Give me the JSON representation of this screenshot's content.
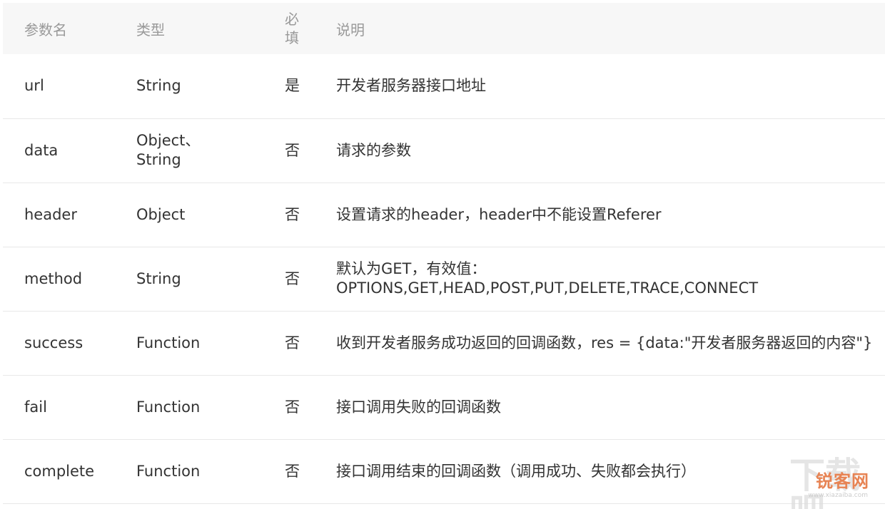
{
  "table": {
    "headers": {
      "name": "参数名",
      "type": "类型",
      "required_line1": "必",
      "required_line2": "填",
      "description": "说明"
    },
    "rows": [
      {
        "name": "url",
        "type_line1": "String",
        "type_line2": "",
        "required": "是",
        "description_line1": "开发者服务器接口地址",
        "description_line2": ""
      },
      {
        "name": "data",
        "type_line1": "Object、",
        "type_line2": "String",
        "required": "否",
        "description_line1": "请求的参数",
        "description_line2": ""
      },
      {
        "name": "header",
        "type_line1": "Object",
        "type_line2": "",
        "required": "否",
        "description_line1": "设置请求的header，header中不能设置Referer",
        "description_line2": ""
      },
      {
        "name": "method",
        "type_line1": "String",
        "type_line2": "",
        "required": "否",
        "description_line1": "默认为GET，有效值：",
        "description_line2": "OPTIONS,GET,HEAD,POST,PUT,DELETE,TRACE,CONNECT"
      },
      {
        "name": "success",
        "type_line1": "Function",
        "type_line2": "",
        "required": "否",
        "description_line1": "收到开发者服务成功返回的回调函数，res = {data:\"开发者服务器返回的内容\"}",
        "description_line2": ""
      },
      {
        "name": "fail",
        "type_line1": "Function",
        "type_line2": "",
        "required": "否",
        "description_line1": "接口调用失败的回调函数",
        "description_line2": ""
      },
      {
        "name": "complete",
        "type_line1": "Function",
        "type_line2": "",
        "required": "否",
        "description_line1": "接口调用结束的回调函数（调用成功、失败都会执行）",
        "description_line2": ""
      }
    ]
  },
  "watermark": {
    "logo_text": "锐客网",
    "bg_text": "下载吧",
    "sub_text": "www.xiazaiba.com"
  }
}
